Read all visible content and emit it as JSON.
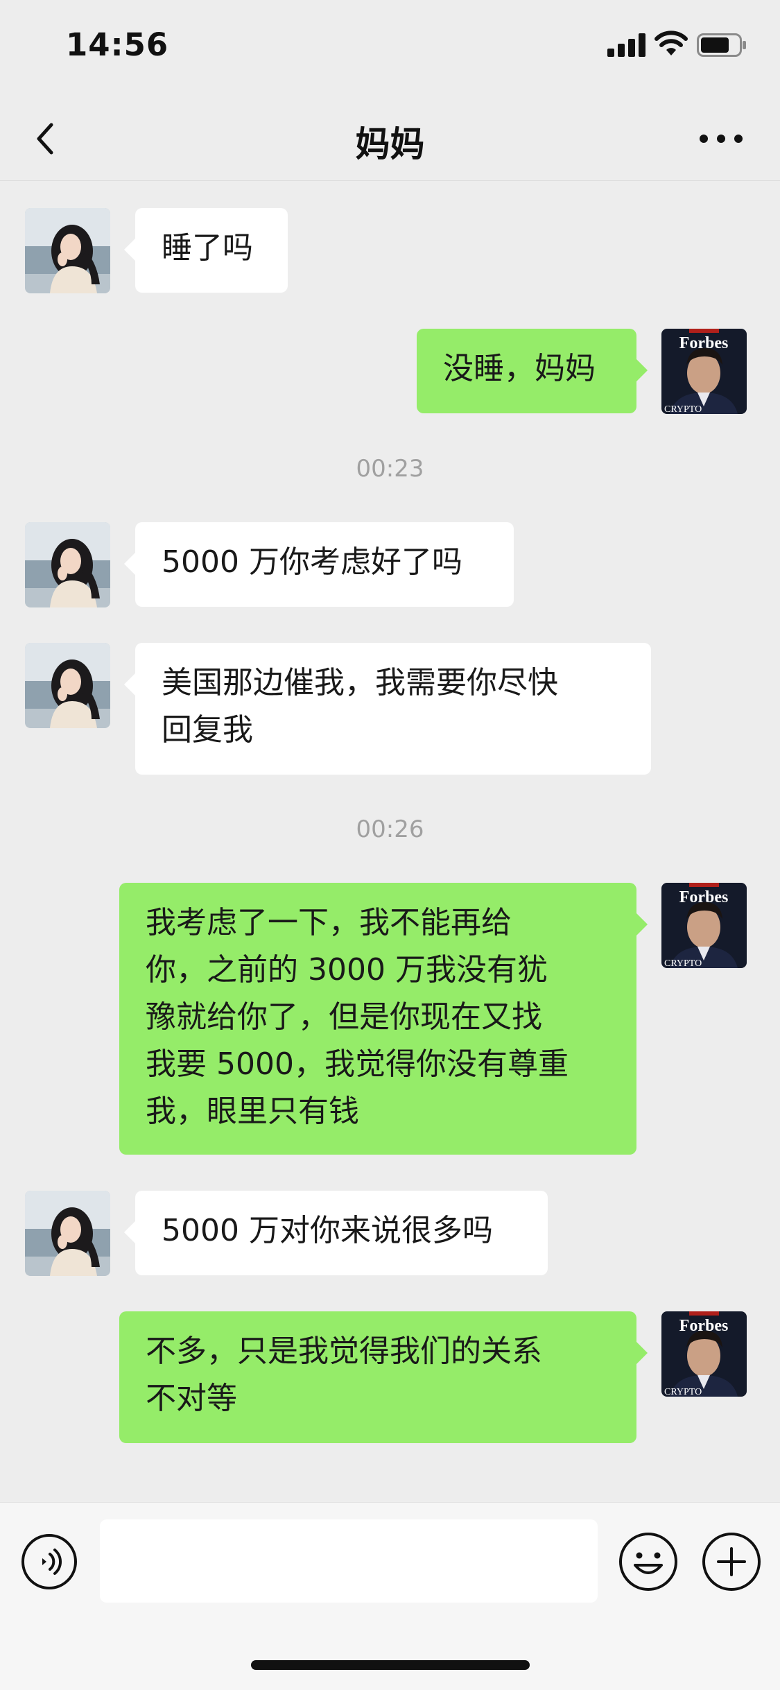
{
  "status_bar": {
    "time": "14:56"
  },
  "chat": {
    "title": "妈妈"
  },
  "messages": [
    {
      "side": "in",
      "text": "睡了吗"
    },
    {
      "side": "out",
      "text": "没睡，妈妈"
    },
    {
      "timestamp": "00:23"
    },
    {
      "side": "in",
      "text": "5000 万你考虑好了吗"
    },
    {
      "side": "in",
      "text": "美国那边催我，我需要你尽快\n回复我"
    },
    {
      "timestamp": "00:26"
    },
    {
      "side": "out",
      "text": "我考虑了一下，我不能再给\n你，之前的 3000 万我没有犹\n豫就给你了，但是你现在又找\n我要 5000，我觉得你没有尊重\n我，眼里只有钱"
    },
    {
      "side": "in",
      "text": "5000 万对你来说很多吗"
    },
    {
      "side": "out",
      "text": "不多，只是我觉得我们的关系\n不对等"
    }
  ],
  "avatar_badges": {
    "magazine_title": "Forbes",
    "magazine_footer": "CRYPTO"
  },
  "input": {
    "placeholder": ""
  },
  "colors": {
    "outgoing_bubble": "#95ec69",
    "incoming_bubble": "#ffffff",
    "background": "#ededed"
  }
}
